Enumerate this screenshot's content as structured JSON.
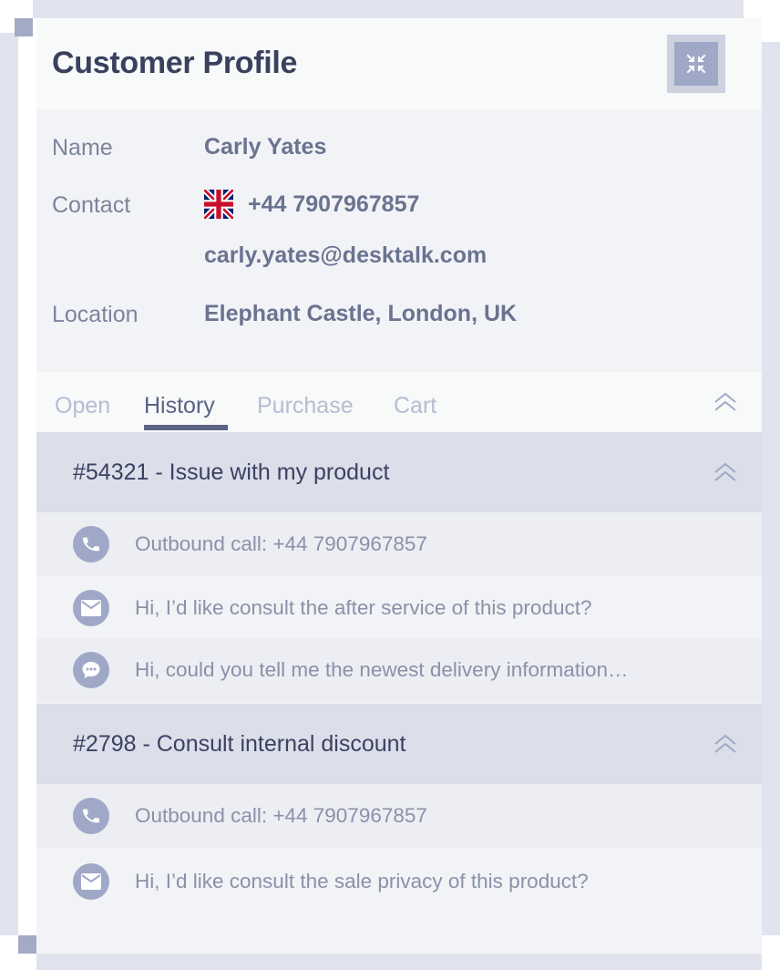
{
  "card": {
    "title": "Customer Profile",
    "collapse_icon": "collapse-arrows-icon"
  },
  "profile": {
    "name_label": "Name",
    "name_value": "Carly Yates",
    "contact_label": "Contact",
    "phone": "+44 7907967857",
    "phone_flag": "uk-flag-icon",
    "email": "carly.yates@desktalk.com",
    "location_label": "Location",
    "location_value": "Elephant Castle, London, UK"
  },
  "tabs": [
    {
      "label": "Open",
      "active": false
    },
    {
      "label": "History",
      "active": true
    },
    {
      "label": "Purchase",
      "active": false
    },
    {
      "label": "Cart",
      "active": false
    }
  ],
  "tickets": [
    {
      "title": "#54321 - Issue with my product",
      "items": [
        {
          "icon": "phone-icon",
          "text": "Outbound call: +44 7907967857"
        },
        {
          "icon": "mail-icon",
          "text": "Hi, I’d like consult the after service of this product?"
        },
        {
          "icon": "chat-icon",
          "text": "Hi, could you tell me the newest delivery information…"
        }
      ]
    },
    {
      "title": "#2798 - Consult internal discount",
      "items": [
        {
          "icon": "phone-icon",
          "text": "Outbound call: +44 7907967857"
        },
        {
          "icon": "mail-icon",
          "text": "Hi, I’d like consult the sale privacy of this product?"
        }
      ]
    }
  ],
  "colors": {
    "title": "#39415e",
    "accent": "#a0a8c7",
    "ticket_header_bg": "#dcdee9",
    "tab_active": "#5a6385",
    "tab_inactive": "#b6bcd2"
  }
}
